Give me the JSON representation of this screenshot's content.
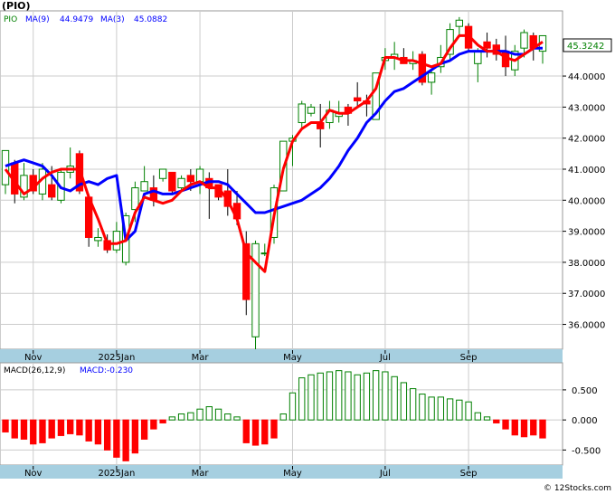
{
  "chart_data": [
    {
      "type": "candlestick",
      "title": "(PIO)",
      "legend": [
        {
          "name": "PIO",
          "color": "#008000"
        },
        {
          "name": "MA(9)",
          "value": "44.9479",
          "color": "#0000ff"
        },
        {
          "name": "MA(3)",
          "value": "45.0882",
          "color": "#0000ff"
        }
      ],
      "last_price_label": "45.3242",
      "y_ticks": [
        "36.0000",
        "37.0000",
        "38.0000",
        "39.0000",
        "40.0000",
        "41.0000",
        "42.0000",
        "43.0000",
        "44.0000"
      ],
      "y_tick_values": [
        36,
        37,
        38,
        39,
        40,
        41,
        42,
        43,
        44
      ],
      "ylim": [
        35.2,
        46.1
      ],
      "x_labels": [
        {
          "label": "Nov",
          "index": 3
        },
        {
          "label": "2025Jan",
          "index": 12
        },
        {
          "label": "Mar",
          "index": 21
        },
        {
          "label": "May",
          "index": 31
        },
        {
          "label": "Jul",
          "index": 41
        },
        {
          "label": "Sep",
          "index": 50
        }
      ],
      "ohlc": [
        [
          40.5,
          41.6,
          40.2,
          41.6
        ],
        [
          41.2,
          41.3,
          39.9,
          40.2
        ],
        [
          40.1,
          41.2,
          40.0,
          40.8
        ],
        [
          40.8,
          41.0,
          40.2,
          40.3
        ],
        [
          40.2,
          41.2,
          40.0,
          41.0
        ],
        [
          40.5,
          41.1,
          40.0,
          40.1
        ],
        [
          40.0,
          41.0,
          39.9,
          40.9
        ],
        [
          40.9,
          41.7,
          40.7,
          41.1
        ],
        [
          41.5,
          41.6,
          40.2,
          40.3
        ],
        [
          40.1,
          40.2,
          38.5,
          38.8
        ],
        [
          38.7,
          39.1,
          38.5,
          38.8
        ],
        [
          38.7,
          38.9,
          38.3,
          38.4
        ],
        [
          38.4,
          39.3,
          38.3,
          39.0
        ],
        [
          38.0,
          39.6,
          37.9,
          39.5
        ],
        [
          39.7,
          40.6,
          39.3,
          40.4
        ],
        [
          40.3,
          41.1,
          40.3,
          40.6
        ],
        [
          40.4,
          40.8,
          39.8,
          40.0
        ],
        [
          40.7,
          41.0,
          40.6,
          41.0
        ],
        [
          40.9,
          40.9,
          40.2,
          40.3
        ],
        [
          40.4,
          40.8,
          40.3,
          40.7
        ],
        [
          40.8,
          41.0,
          40.3,
          40.6
        ],
        [
          40.6,
          41.1,
          40.2,
          41.0
        ],
        [
          40.7,
          40.9,
          39.4,
          40.4
        ],
        [
          40.5,
          40.5,
          40.0,
          40.1
        ],
        [
          40.3,
          41.0,
          39.5,
          39.8
        ],
        [
          39.9,
          40.3,
          39.2,
          39.4
        ],
        [
          38.6,
          39.0,
          36.3,
          36.8
        ],
        [
          35.6,
          38.7,
          35.2,
          38.6
        ],
        [
          38.3,
          38.6,
          38.2,
          38.3
        ],
        [
          38.8,
          40.5,
          38.6,
          40.4
        ],
        [
          40.3,
          41.9,
          40.3,
          41.9
        ],
        [
          41.9,
          42.1,
          41.1,
          42.0
        ],
        [
          42.5,
          43.2,
          42.3,
          43.1
        ],
        [
          42.8,
          43.1,
          42.7,
          43.0
        ],
        [
          42.5,
          43.1,
          41.7,
          42.3
        ],
        [
          42.5,
          43.2,
          42.3,
          42.9
        ],
        [
          42.7,
          43.2,
          42.5,
          42.8
        ],
        [
          43.0,
          43.1,
          42.4,
          42.8
        ],
        [
          43.3,
          43.8,
          43.0,
          43.2
        ],
        [
          43.2,
          43.4,
          42.7,
          43.1
        ],
        [
          42.6,
          43.6,
          42.6,
          44.1
        ],
        [
          44.5,
          44.9,
          44.2,
          44.6
        ],
        [
          44.6,
          45.1,
          44.2,
          44.7
        ],
        [
          44.6,
          44.9,
          44.4,
          44.4
        ],
        [
          44.4,
          44.8,
          44.2,
          44.5
        ],
        [
          44.7,
          44.8,
          43.7,
          43.8
        ],
        [
          43.8,
          44.2,
          43.4,
          44.1
        ],
        [
          44.3,
          45.0,
          44.1,
          44.6
        ],
        [
          44.7,
          45.7,
          44.5,
          45.5
        ],
        [
          45.6,
          45.9,
          45.3,
          45.8
        ],
        [
          45.6,
          45.7,
          44.8,
          44.9
        ],
        [
          44.4,
          44.9,
          43.8,
          44.8
        ],
        [
          45.1,
          45.4,
          44.6,
          44.9
        ],
        [
          45.0,
          45.2,
          44.5,
          44.7
        ],
        [
          44.8,
          45.3,
          44.0,
          44.3
        ],
        [
          44.2,
          45.0,
          44.0,
          44.8
        ],
        [
          44.9,
          45.5,
          44.6,
          45.4
        ],
        [
          45.3,
          45.4,
          44.5,
          44.9
        ],
        [
          44.8,
          45.3,
          44.4,
          45.3
        ]
      ],
      "ma9": [
        41.1,
        41.2,
        41.3,
        41.2,
        41.1,
        40.8,
        40.4,
        40.3,
        40.5,
        40.6,
        40.5,
        40.7,
        40.8,
        38.7,
        39.0,
        40.2,
        40.3,
        40.2,
        40.2,
        40.3,
        40.4,
        40.5,
        40.6,
        40.6,
        40.5,
        40.2,
        39.9,
        39.6,
        39.6,
        39.7,
        39.8,
        39.9,
        40.0,
        40.2,
        40.4,
        40.7,
        41.1,
        41.6,
        42.0,
        42.5,
        42.8,
        43.2,
        43.5,
        43.6,
        43.8,
        44.0,
        44.2,
        44.4,
        44.5,
        44.7,
        44.8,
        44.8,
        44.8,
        44.8,
        44.8,
        44.7,
        44.7,
        44.9,
        44.9
      ],
      "ma3": [
        41.0,
        40.6,
        40.2,
        40.4,
        40.7,
        40.9,
        41.0,
        41.0,
        41.0,
        40.1,
        39.4,
        38.6,
        38.6,
        38.7,
        39.6,
        40.1,
        40.0,
        39.9,
        40.0,
        40.3,
        40.5,
        40.6,
        40.4,
        40.4,
        40.0,
        39.4,
        38.3,
        38.0,
        37.7,
        39.5,
        41.0,
        41.9,
        42.3,
        42.5,
        42.5,
        42.9,
        42.8,
        42.8,
        43.0,
        43.2,
        43.6,
        44.6,
        44.6,
        44.5,
        44.5,
        44.4,
        44.3,
        44.4,
        44.9,
        45.3,
        45.3,
        45.0,
        44.8,
        44.8,
        44.6,
        44.5,
        44.7,
        44.9,
        45.1
      ]
    },
    {
      "type": "bar",
      "title": "MACD(26,12,9)",
      "subtitle": "MACD:-0.230",
      "y_ticks": [
        "0.500",
        "0.000",
        "-0.500"
      ],
      "y_tick_values": [
        0.5,
        0,
        -0.5
      ],
      "ylim": [
        -0.75,
        0.95
      ],
      "x_labels": [
        {
          "label": "Nov",
          "index": 3
        },
        {
          "label": "2025Jan",
          "index": 12
        },
        {
          "label": "Mar",
          "index": 21
        },
        {
          "label": "May",
          "index": 31
        },
        {
          "label": "Jul",
          "index": 41
        },
        {
          "label": "Sep",
          "index": 50
        }
      ],
      "values": [
        -0.2,
        -0.3,
        -0.32,
        -0.4,
        -0.38,
        -0.3,
        -0.26,
        -0.23,
        -0.25,
        -0.35,
        -0.4,
        -0.5,
        -0.62,
        -0.68,
        -0.55,
        -0.32,
        -0.15,
        -0.05,
        0.05,
        0.1,
        0.12,
        0.18,
        0.22,
        0.18,
        0.1,
        0.05,
        -0.38,
        -0.42,
        -0.4,
        -0.3,
        0.1,
        0.45,
        0.7,
        0.75,
        0.78,
        0.8,
        0.82,
        0.8,
        0.75,
        0.78,
        0.82,
        0.8,
        0.72,
        0.62,
        0.52,
        0.43,
        0.38,
        0.38,
        0.35,
        0.33,
        0.3,
        0.12,
        0.05,
        -0.05,
        -0.15,
        -0.25,
        -0.28,
        -0.25,
        -0.3
      ]
    }
  ],
  "footer": {
    "copyright": "© 12Stocks.com"
  },
  "colors": {
    "up": "#008000",
    "down": "#ff0000",
    "ma_blue": "#0000ff",
    "ma_red": "#ff0000",
    "axis_band": "#a6cfe0",
    "grid": "#cccccc",
    "panel_bg": "#ffffff"
  }
}
